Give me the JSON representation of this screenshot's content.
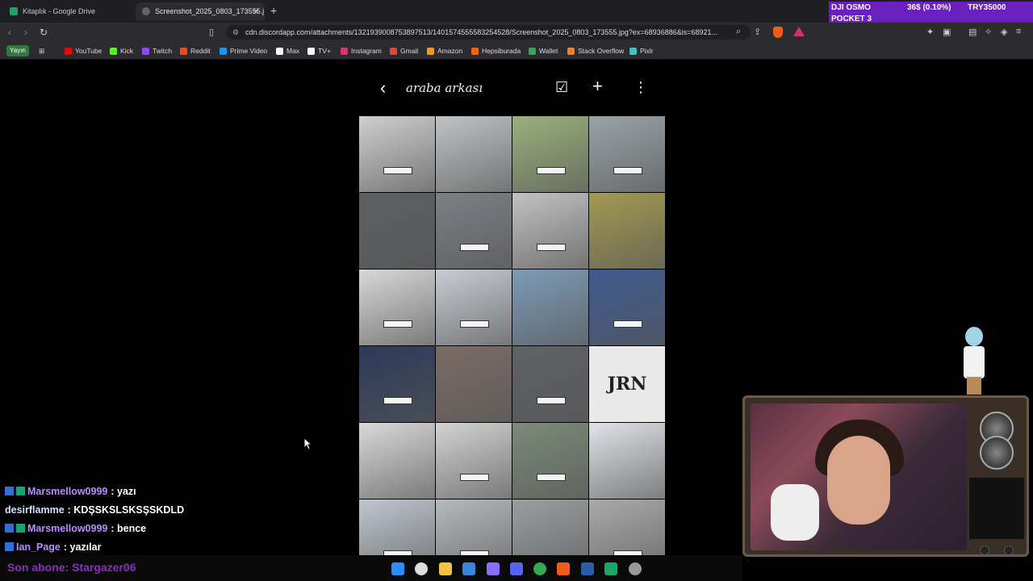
{
  "browser": {
    "tabs": [
      {
        "title": "Kitaplık - Google Drive",
        "active": false
      },
      {
        "title": "Screenshot_2025_0803_173555.j",
        "active": true
      }
    ],
    "url": "cdn.discordapp.com/attachments/1321939008753897513/1401574555583254528/Screenshot_2025_0803_173555.jpg?ex=68936886&is=68921...",
    "bookmarks": [
      "YouTube",
      "Kick",
      "Twitch",
      "Reddit",
      "Prime Video",
      "Max",
      "TV+",
      "Instagram",
      "Gmail",
      "Amazon",
      "Hepsiburada",
      "Wallet",
      "Stack Overflow",
      "Pixlr"
    ],
    "bookmark_colors": [
      "#ff0000",
      "#53fc18",
      "#9146ff",
      "#ff4500",
      "#1399ff",
      "#ffffff",
      "#ffffff",
      "#e1306c",
      "#ea4335",
      "#ff9900",
      "#ff6000",
      "#34a853",
      "#f48024",
      "#3ec5c1"
    ],
    "yayin_label": "Yayın"
  },
  "ticker": {
    "name": "DJI OSMO",
    "name2": "POCKET 3",
    "change": "36$ (0.10%)",
    "price": "TRY35000"
  },
  "gallery": {
    "title": "araba arkası",
    "thumb_text": "JRN",
    "thumb_colors": [
      "#cfcfcf",
      "#bfc3c5",
      "#9bb07c",
      "#9aa3a8",
      "#5d6063",
      "#7d7f86",
      "#c2c2c2",
      "#a39a52",
      "#d8d8d8",
      "#c9ccd4",
      "#7d9bb7",
      "#3e5a8f",
      "#2c3a5a",
      "#7a6c66",
      "#5f6166",
      "#e7e7e7",
      "#d9d9d9",
      "#d3d3d3",
      "#7c8a7a",
      "#e0e3e8",
      "#bfc6cf",
      "#b7b9bd",
      "#9b9ea0",
      "#aaaaaa"
    ]
  },
  "chat": [
    {
      "user": "Marsmellow0999",
      "message": ": yazı",
      "color": "#b88cff",
      "badges": 2
    },
    {
      "user": "desirflamme",
      "message": ": KDŞSKSLSKSŞSKDLD",
      "color": "#cfe0ff",
      "badges": 0
    },
    {
      "user": "Marsmellow0999",
      "message": ": bence",
      "color": "#b88cff",
      "badges": 2
    },
    {
      "user": "Ian_Page",
      "message": ": yazılar",
      "color": "#b88cff",
      "badges": 1
    }
  ],
  "subscriber": "Son abone: Stargazer06",
  "taskbar_icons": [
    "windows-icon",
    "search-icon",
    "file-explorer-icon",
    "store-icon",
    "obs-icon",
    "discord-icon",
    "chrome-icon",
    "brave-icon",
    "steam-icon",
    "sheets-icon",
    "settings-icon"
  ]
}
